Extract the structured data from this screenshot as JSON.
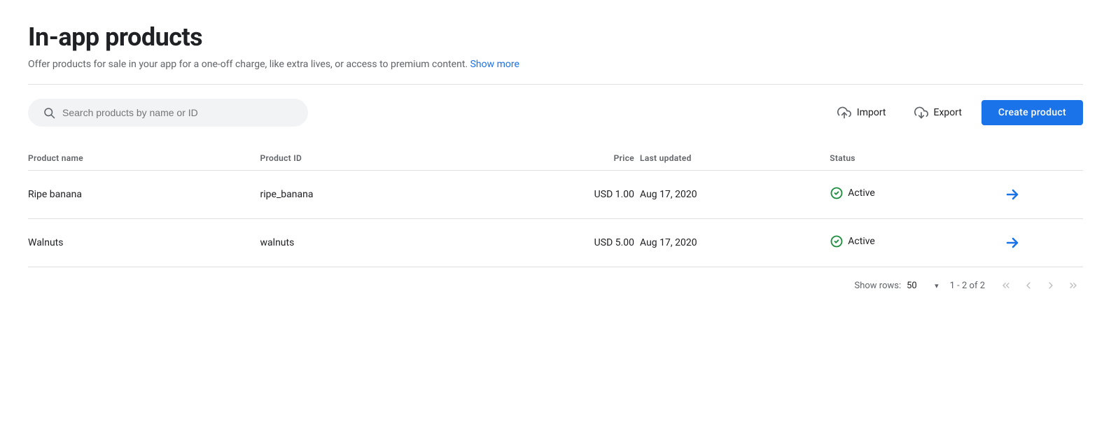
{
  "page": {
    "title": "In-app products",
    "subtitle": "Offer products for sale in your app for a one-off charge, like extra lives, or access to premium content.",
    "show_more_label": "Show more"
  },
  "toolbar": {
    "search_placeholder": "Search products by name or ID",
    "import_label": "Import",
    "export_label": "Export",
    "create_label": "Create product"
  },
  "table": {
    "columns": [
      {
        "key": "name",
        "label": "Product name"
      },
      {
        "key": "id",
        "label": "Product ID"
      },
      {
        "key": "price",
        "label": "Price"
      },
      {
        "key": "updated",
        "label": "Last updated"
      },
      {
        "key": "status",
        "label": "Status"
      }
    ],
    "rows": [
      {
        "name": "Ripe banana",
        "id": "ripe_banana",
        "price": "USD 1.00",
        "updated": "Aug 17, 2020",
        "status": "Active"
      },
      {
        "name": "Walnuts",
        "id": "walnuts",
        "price": "USD 5.00",
        "updated": "Aug 17, 2020",
        "status": "Active"
      }
    ]
  },
  "pagination": {
    "rows_label": "Show rows:",
    "rows_value": "50",
    "page_info": "1 - 2 of 2"
  },
  "colors": {
    "accent": "#1a73e8",
    "active_status": "#1e8e3e"
  }
}
